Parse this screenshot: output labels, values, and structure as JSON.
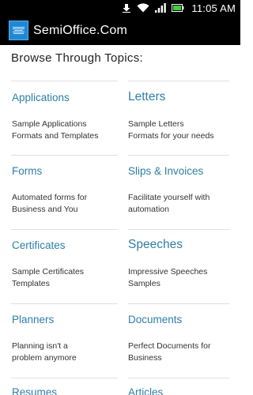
{
  "status_bar": {
    "time": "11:05",
    "ampm": "AM"
  },
  "app": {
    "title": "SemiOffice.Com"
  },
  "browse_heading": "Browse Through Topics:",
  "topics": [
    {
      "title": "Applications",
      "line1": "Sample Applications",
      "line2": "Formats and Templates"
    },
    {
      "title": "Letters",
      "line1": "Sample Letters",
      "line2": "Formats for your needs"
    },
    {
      "title": "Forms",
      "line1": "Automated forms for",
      "line2": "Business and You"
    },
    {
      "title": "Slips & Invoices",
      "line1": "Facilitate yourself with",
      "line2": "automation"
    },
    {
      "title": "Certificates",
      "line1": "Sample Certificates",
      "line2": "Templates"
    },
    {
      "title": "Speeches",
      "line1": "Impressive Speeches",
      "line2": "Samples"
    },
    {
      "title": "Planners",
      "line1": "Planning isn't a",
      "line2": "problem anymore"
    },
    {
      "title": "Documents",
      "line1": "Perfect Documents for",
      "line2": "Business"
    },
    {
      "title": "Resumes",
      "line1": "",
      "line2": ""
    },
    {
      "title": "Articles",
      "line1": "",
      "line2": ""
    }
  ]
}
